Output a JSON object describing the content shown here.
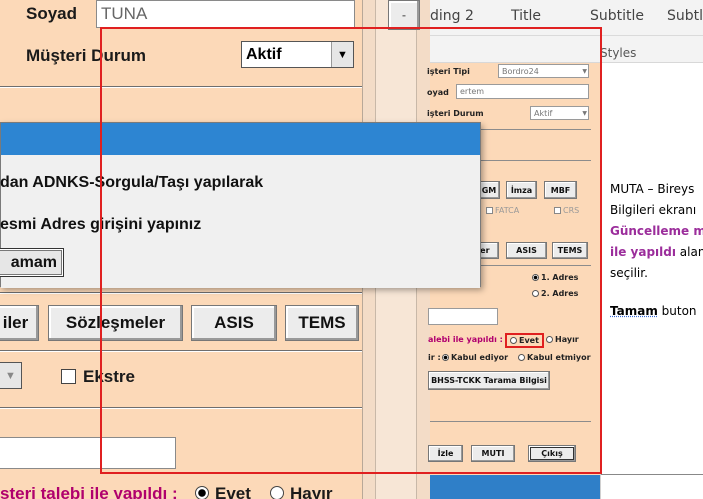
{
  "form_zoom": {
    "soyad_label": "Soyad",
    "soyad_value": "TUNA",
    "musteri_durum_label": "Müşteri Durum",
    "musteri_durum_value": "Aktif",
    "buttons": [
      "iler",
      "Sözleşmeler",
      "ASIS",
      "TEMS"
    ],
    "ekstre_label": "Ekstre",
    "guncelleme_label": "şteri talebi ile yapıldı :",
    "evet_label": "Evet",
    "hayir_label": "Hayır",
    "side_button_glyph": "-"
  },
  "dialog": {
    "line1": "dan ADNKS-Sorgula/Taşı yapılarak",
    "line2": "esmi Adres girişini yapınız",
    "ok_label": "amam"
  },
  "app_window": {
    "musteri_tipi_label": "işteri Tipi",
    "musteri_tipi_value": "Bordro24",
    "soyad_label": "oyad",
    "soyad_value": "ertem",
    "musteri_durum_label": "işteri Durum",
    "musteri_durum_value": "Aktif",
    "buttons_row1": [
      "GM",
      "İmza",
      "MBF"
    ],
    "fatca_label": "FATCA",
    "crs_label": "CRS",
    "buttons_row2": [
      "ler",
      "ASIS",
      "TEMS"
    ],
    "adres1_label": "1. Adres",
    "adres2_label": "2. Adres",
    "talep_label": "alebi ile yapıldı :",
    "evet_label": "Evet",
    "hayir_label": "Hayır",
    "kabul_label_prefix": "ir :",
    "kabul_ediyor": "Kabul ediyor",
    "kabul_etmiyor": "Kabul etmiyor",
    "bhss_button": "BHSS-TCKK Tarama Bilgisi",
    "bottom_buttons": [
      "İzle",
      "MUTI",
      "Çıkış"
    ]
  },
  "word": {
    "styles": [
      "ding 2",
      "Title",
      "Subtitle",
      "Subtle"
    ],
    "styles_group_label": "Styles",
    "lines": [
      {
        "text": "MUTA – Bireys",
        "color": "#000000",
        "bold": false
      },
      {
        "text": "Bilgileri ekranı",
        "color": "#000000",
        "bold": false
      },
      {
        "text": "Güncelleme m",
        "color": "#9b2d9b",
        "bold": true
      },
      {
        "text": "ile yapıldı alan",
        "color": "#9b2d9b",
        "bold": true,
        "mixed": true
      },
      {
        "text": "seçilir.",
        "color": "#000000",
        "bold": false
      }
    ],
    "tamam_bold": "Tamam",
    "tamam_rest": " buton"
  },
  "colors": {
    "highlight_red": "#e02020",
    "dialog_title_blue": "#2d85d2",
    "form_background": "#fcd9b8",
    "purple_text": "#9b2d9b"
  }
}
